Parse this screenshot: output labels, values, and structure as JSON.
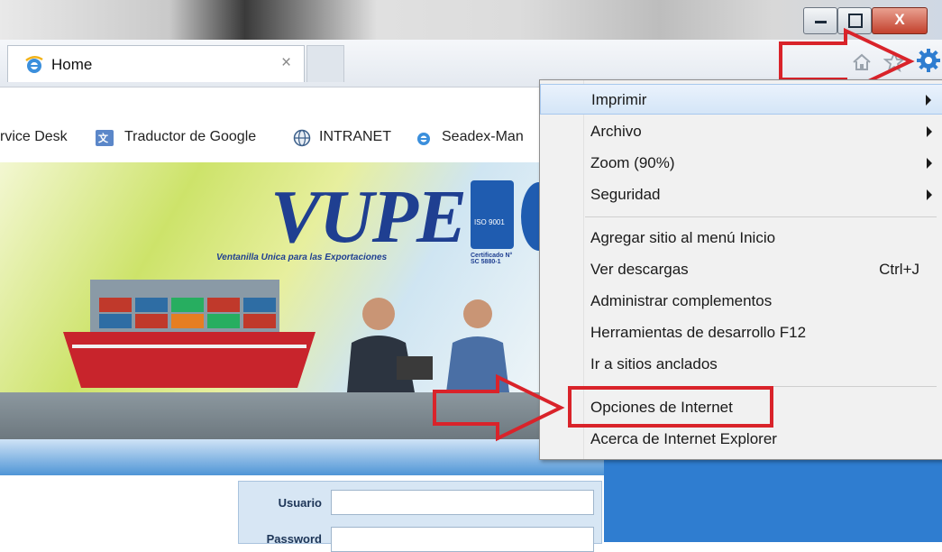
{
  "browser": {
    "tab_title": "Home",
    "tab_close": "×",
    "window_buttons": {
      "minimize": "▬",
      "restore": "❐",
      "close": "X"
    },
    "favorites": [
      {
        "label": "rvice Desk",
        "icon": "none"
      },
      {
        "label": "Traductor de Google",
        "icon": "google-translate-icon"
      },
      {
        "label": "INTRANET",
        "icon": "globe-icon"
      },
      {
        "label": "Seadex-Man",
        "icon": "ie-icon"
      }
    ]
  },
  "tools_menu": {
    "items": [
      {
        "label": "Imprimir",
        "submenu": true,
        "highlighted": true
      },
      {
        "label": "Archivo",
        "submenu": true
      },
      {
        "label": "Zoom (90%)",
        "submenu": true
      },
      {
        "label": "Seguridad",
        "submenu": true
      },
      {
        "label": "Agregar sitio al menú Inicio"
      },
      {
        "label": "Ver descargas",
        "shortcut": "Ctrl+J"
      },
      {
        "label": "Administrar complementos"
      },
      {
        "label": "Herramientas de desarrollo F12"
      },
      {
        "label": "Ir a sitios anclados"
      },
      {
        "label": "Opciones de Internet",
        "annotated": true
      },
      {
        "label": "Acerca de Internet Explorer"
      }
    ]
  },
  "page": {
    "logo_text": "VUPE",
    "logo_subtitle": "Ventanilla Unica para las Exportaciones",
    "cert_text": "Certificado N° SC 5880-1",
    "iso_text": "ISO 9001",
    "login": {
      "user_label": "Usuario",
      "password_label": "Password"
    }
  },
  "colors": {
    "annotation": "#d9232a",
    "menu_highlight": "#d4e5f7",
    "page_blue": "#2f7dd0"
  }
}
